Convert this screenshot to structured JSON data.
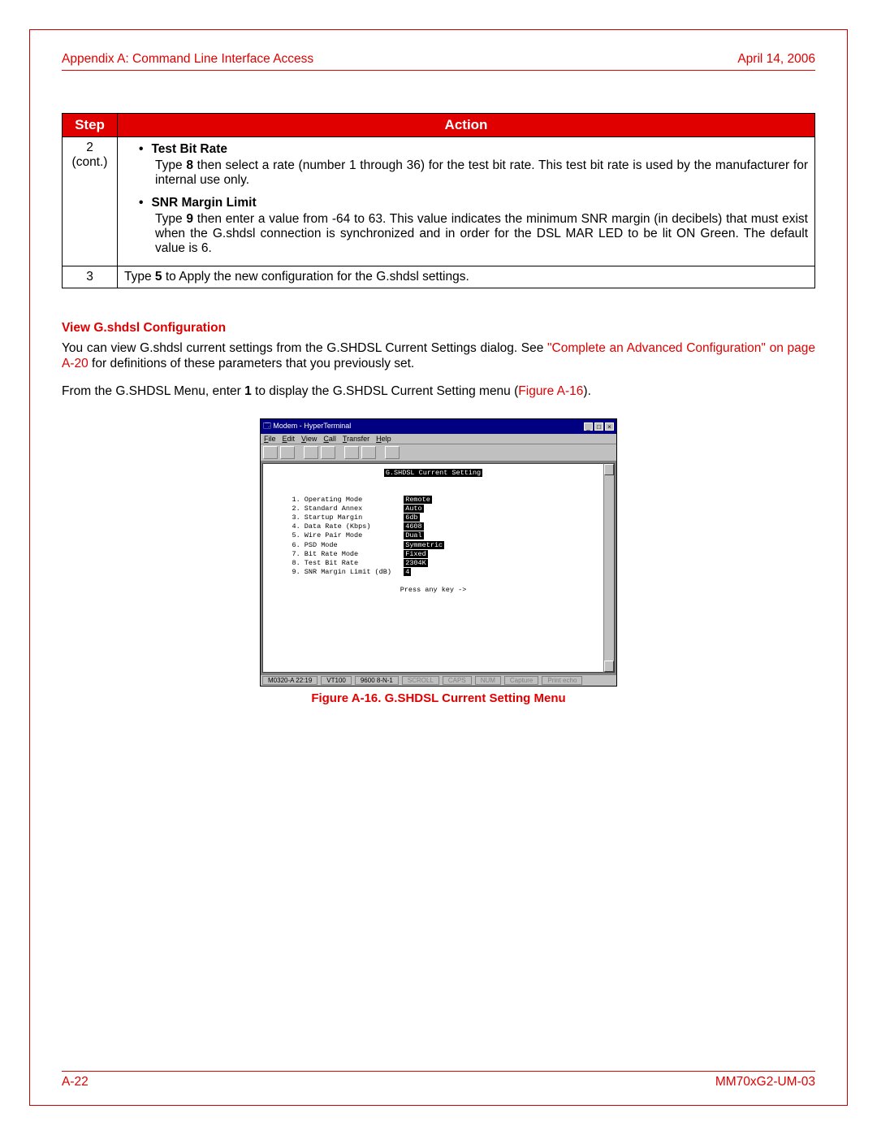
{
  "header": {
    "left": "Appendix A: Command Line Interface Access",
    "right": "April 14, 2006"
  },
  "table": {
    "head": {
      "step": "Step",
      "action": "Action"
    },
    "rows": [
      {
        "step_line1": "2",
        "step_line2": "(cont.)",
        "items": [
          {
            "title": "Test Bit Rate",
            "body_pre": "Type ",
            "body_bold": "8",
            "body_post": " then select a rate (number 1 through 36) for the test bit rate. This test bit rate is used by the manufacturer for internal use only."
          },
          {
            "title": "SNR Margin Limit",
            "body_pre": "Type ",
            "body_bold": "9",
            "body_post": " then enter a value from -64 to 63. This value indicates the minimum SNR margin (in decibels) that must exist when the G.shdsl connection is synchronized and in order for the DSL MAR LED to be lit ON Green. The default value is 6."
          }
        ]
      },
      {
        "step_line1": "3",
        "action_pre": "Type ",
        "action_bold": "5",
        "action_post": " to Apply the new configuration for the G.shdsl settings."
      }
    ]
  },
  "section": {
    "heading": "View G.shdsl Configuration",
    "p1_pre": "You can view G.shdsl current settings from the G.SHDSL Current Settings dialog. See ",
    "p1_link": "\"Complete an Advanced Configuration\" on page A-20",
    "p1_post": " for definitions of these parameters that you previously set.",
    "p2_pre": "From the G.SHDSL Menu, enter ",
    "p2_bold": "1",
    "p2_mid": " to display the G.SHDSL Current Setting menu (",
    "p2_link": "Figure A-16",
    "p2_post": ")."
  },
  "figure": {
    "window_title": "Modem - HyperTerminal",
    "menu": [
      "File",
      "Edit",
      "View",
      "Call",
      "Transfer",
      "Help"
    ],
    "terminal_title": "G.SHDSL Current Setting",
    "lines": [
      {
        "n": "1",
        "label": "Operating Mode",
        "value": "Remote"
      },
      {
        "n": "2",
        "label": "Standard Annex",
        "value": "Auto"
      },
      {
        "n": "3",
        "label": "Startup Margin",
        "value": "6db"
      },
      {
        "n": "4",
        "label": "Data Rate (Kbps)",
        "value": "4608"
      },
      {
        "n": "5",
        "label": "Wire Pair Mode",
        "value": "Dual"
      },
      {
        "n": "6",
        "label": "PSD Mode",
        "value": "Symmetric"
      },
      {
        "n": "7",
        "label": "Bit Rate Mode",
        "value": "Fixed"
      },
      {
        "n": "8",
        "label": "Test Bit Rate",
        "value": "2304K"
      },
      {
        "n": "9",
        "label": "SNR Margin Limit (dB)",
        "value": "4"
      }
    ],
    "prompt": "Press any key ->",
    "status": {
      "c0": "M0320-A  22:19",
      "c1": "VT100",
      "c2": "9600 8-N-1",
      "c3": "SCROLL",
      "c4": "CAPS",
      "c5": "NUM",
      "c6": "Capture",
      "c7": "Print echo"
    },
    "caption": "Figure A-16. G.SHDSL Current Setting Menu"
  },
  "footer": {
    "left": "A-22",
    "right": "MM70xG2-UM-03"
  }
}
